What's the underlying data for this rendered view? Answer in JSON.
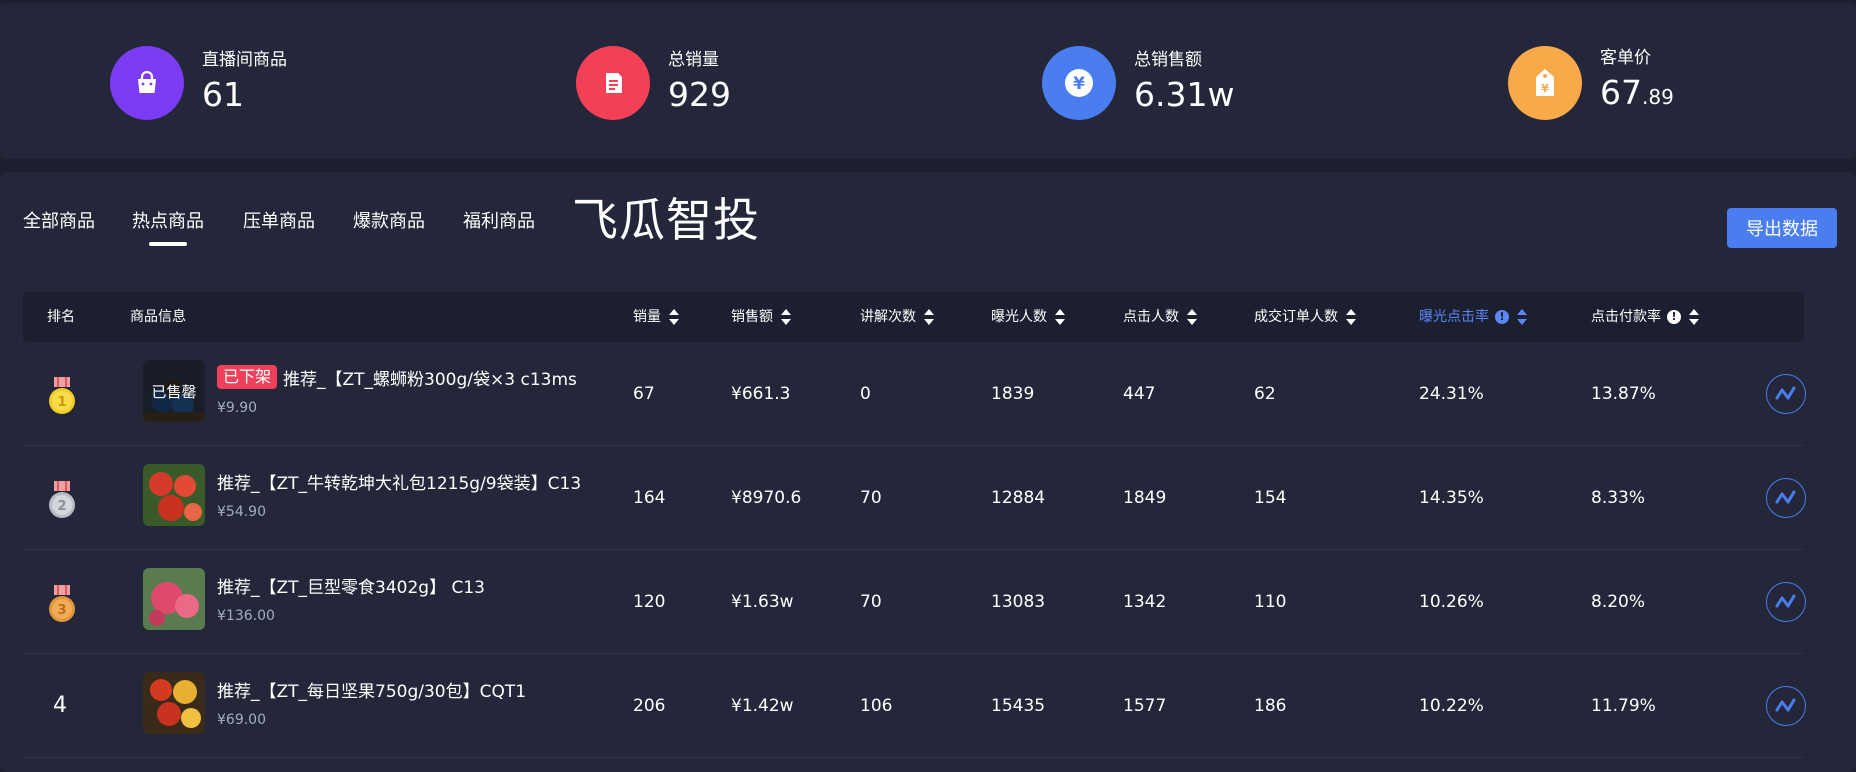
{
  "stats": [
    {
      "label": "直播间商品",
      "value": "61",
      "frac": "",
      "icon": "shopping-bag-icon",
      "color": "#7b3cf4"
    },
    {
      "label": "总销量",
      "value": "929",
      "frac": "",
      "icon": "document-icon",
      "color": "#f44057"
    },
    {
      "label": "总销售额",
      "value": "6.31w",
      "frac": "",
      "icon": "yuan-icon",
      "color": "#4a7df0"
    },
    {
      "label": "客单价",
      "value": "67",
      "frac": ".89",
      "icon": "price-tag-icon",
      "color": "#f8a94a"
    }
  ],
  "tabs": [
    "全部商品",
    "热点商品",
    "压单商品",
    "爆款商品",
    "福利商品"
  ],
  "active_tab": "热点商品",
  "brand": "飞瓜智投",
  "export_label": "导出数据",
  "columns": {
    "rank": "排名",
    "info": "商品信息",
    "sales": "销量",
    "amount": "销售额",
    "explains": "讲解次数",
    "exposure": "曝光人数",
    "clicks": "点击人数",
    "orders": "成交订单人数",
    "ctr": "曝光点击率",
    "cvr": "点击付款率"
  },
  "rows": [
    {
      "rank": "1",
      "badge": "已下架",
      "overlay": "已售罄",
      "name": "推荐_【ZT_螺蛳粉300g/袋×3 c13ms",
      "price": "¥9.90",
      "sales": "67",
      "amount": "¥661.3",
      "explains": "0",
      "exposure": "1839",
      "clicks": "447",
      "orders": "62",
      "ctr": "24.31%",
      "cvr": "13.87%"
    },
    {
      "rank": "2",
      "badge": "",
      "overlay": "",
      "name": "推荐_【ZT_牛转乾坤大礼包1215g/9袋装】C13",
      "price": "¥54.90",
      "sales": "164",
      "amount": "¥8970.6",
      "explains": "70",
      "exposure": "12884",
      "clicks": "1849",
      "orders": "154",
      "ctr": "14.35%",
      "cvr": "8.33%"
    },
    {
      "rank": "3",
      "badge": "",
      "overlay": "",
      "name": "推荐_【ZT_巨型零食3402g】 C13",
      "price": "¥136.00",
      "sales": "120",
      "amount": "¥1.63w",
      "explains": "70",
      "exposure": "13083",
      "clicks": "1342",
      "orders": "110",
      "ctr": "10.26%",
      "cvr": "8.20%"
    },
    {
      "rank": "4",
      "badge": "",
      "overlay": "",
      "name": "推荐_【ZT_每日坚果750g/30包】CQT1",
      "price": "¥69.00",
      "sales": "206",
      "amount": "¥1.42w",
      "explains": "106",
      "exposure": "15435",
      "clicks": "1577",
      "orders": "186",
      "ctr": "10.22%",
      "cvr": "11.79%"
    }
  ]
}
